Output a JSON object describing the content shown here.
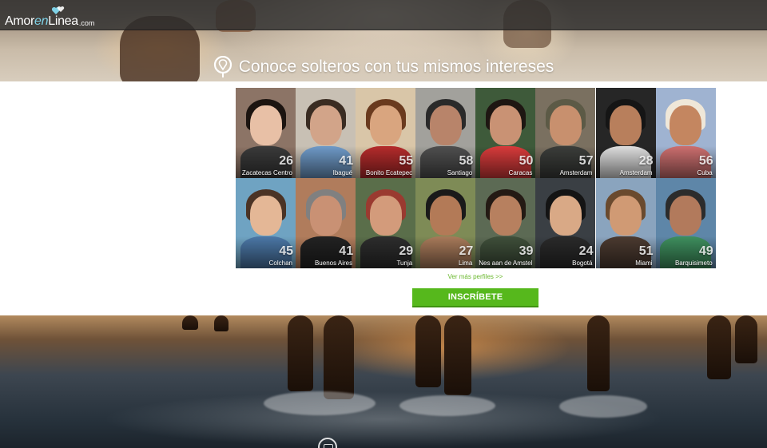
{
  "header": {
    "logo": {
      "part1": "Amor",
      "part2": "en",
      "part3": "Linea",
      "part4": ".com"
    },
    "headline": "Conoce solteros con tus mismos intereses"
  },
  "profiles": [
    {
      "age": "26",
      "city": "Zacatecas Centro",
      "bg": "#8c7466",
      "skin": "#e8c0a6",
      "hair": "#1c1410",
      "shirt": "#3a3a3a"
    },
    {
      "age": "41",
      "city": "Ibagué",
      "bg": "#c8c0b4",
      "skin": "#d2a489",
      "hair": "#3a2c22",
      "shirt": "#6f9ac8"
    },
    {
      "age": "55",
      "city": "Bonito Ecatepec",
      "bg": "#d9c6a8",
      "skin": "#d9a57f",
      "hair": "#6a3a1e",
      "shirt": "#b52b2b"
    },
    {
      "age": "58",
      "city": "Santiago",
      "bg": "#a2a19c",
      "skin": "#b8846a",
      "hair": "#2a2a2a",
      "shirt": "#4f4f4f"
    },
    {
      "age": "50",
      "city": "Caracas",
      "bg": "#3e5a3a",
      "skin": "#c99274",
      "hair": "#1e1612",
      "shirt": "#d83b3b"
    },
    {
      "age": "57",
      "city": "Amsterdam",
      "bg": "#7a7060",
      "skin": "#c8906e",
      "hair": "#5c5a46",
      "shirt": "#3b3d3a"
    },
    {
      "age": "28",
      "city": "Amsterdam",
      "bg": "#262626",
      "skin": "#b87f5c",
      "hair": "#151515",
      "shirt": "#dedede"
    },
    {
      "age": "56",
      "city": "Cuba",
      "bg": "#9fb3d1",
      "skin": "#c48660",
      "hair": "#efe7d8",
      "shirt": "#cc6f6f"
    },
    {
      "age": "45",
      "city": "Colchan",
      "bg": "#6fa3c2",
      "skin": "#e4b796",
      "hair": "#4b3325",
      "shirt": "#4b77a6"
    },
    {
      "age": "41",
      "city": "Buenos Aires",
      "bg": "#b07c5c",
      "skin": "#c99174",
      "hair": "#808080",
      "shirt": "#222222"
    },
    {
      "age": "29",
      "city": "Tunja",
      "bg": "#5a6e4a",
      "skin": "#d39b7b",
      "hair": "#9a3a30",
      "shirt": "#2d2d2d"
    },
    {
      "age": "27",
      "city": "Lima",
      "bg": "#7e8b56",
      "skin": "#b37a57",
      "hair": "#1a1a1a",
      "shirt": "#a87a5a"
    },
    {
      "age": "39",
      "city": "Nes aan de Amstel",
      "bg": "#5c6a54",
      "skin": "#b7805f",
      "hair": "#241a14",
      "shirt": "#3f4f3a"
    },
    {
      "age": "24",
      "city": "Bogotá",
      "bg": "#3a3f44",
      "skin": "#d9a986",
      "hair": "#141414",
      "shirt": "#2a2a2a"
    },
    {
      "age": "51",
      "city": "Miami",
      "bg": "#8aa4be",
      "skin": "#d09a74",
      "hair": "#6a4a2e",
      "shirt": "#4b3a30"
    },
    {
      "age": "49",
      "city": "Barquisimeto",
      "bg": "#5e86a8",
      "skin": "#b27a5c",
      "hair": "#2c2c2c",
      "shirt": "#3e8f5e"
    }
  ],
  "more_link": "Ver más perfiles >>",
  "signup_label": "INSCRÍBETE",
  "colors": {
    "accent": "#56b81c",
    "link": "#6ab82e",
    "topbar": "#2d2d2d"
  }
}
